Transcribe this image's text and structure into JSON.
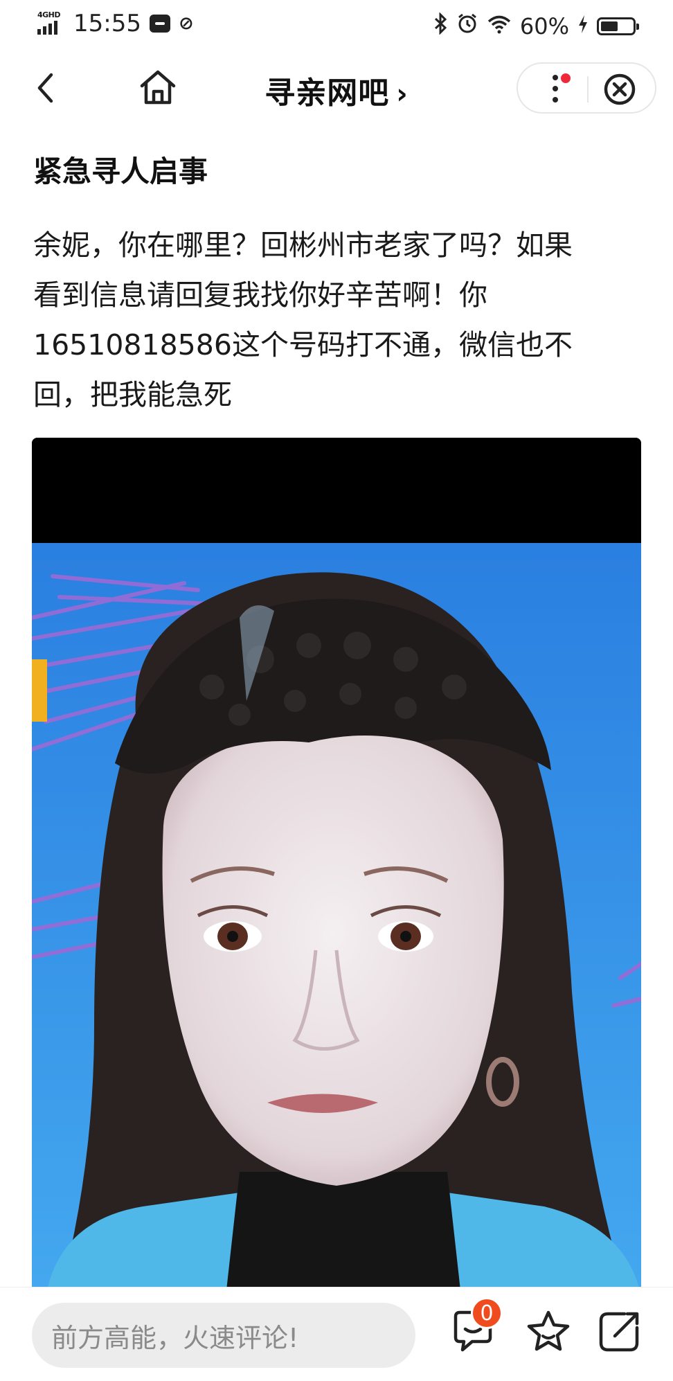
{
  "status_bar": {
    "network_label": "4GHD",
    "time": "15:55",
    "battery_text": "60%",
    "battery_level": 0.6,
    "icons": [
      "signal-icon",
      "message-icon",
      "sim-icon",
      "bluetooth-icon",
      "alarm-icon",
      "wifi-icon",
      "charging-icon",
      "battery-icon"
    ]
  },
  "nav": {
    "title": "寻亲网吧",
    "title_chevron": "›",
    "icons": [
      "back-icon",
      "home-icon",
      "more-icon",
      "close-icon"
    ]
  },
  "post": {
    "title": "紧急寻人启事",
    "body_lines": [
      "余妮，你在哪里？回彬州市老家了吗？如果",
      "看到信息请回复我找你好辛苦啊！你",
      "16510818586这个号码打不通，微信也不",
      "回，把我能急死"
    ],
    "image_subject": "portrait photo of a woman with long dark hair wearing a black crocheted headband, against a blue background with purple flowers"
  },
  "bottom_bar": {
    "comment_placeholder": "前方高能，火速评论!",
    "comment_count": "0",
    "icons": [
      "comment-icon",
      "star-icon",
      "share-icon"
    ]
  },
  "colors": {
    "badge": "#f04b1e",
    "notify_dot": "#f0283c",
    "photo_bg": "#2f8fe6",
    "input_bg": "#ececec"
  }
}
